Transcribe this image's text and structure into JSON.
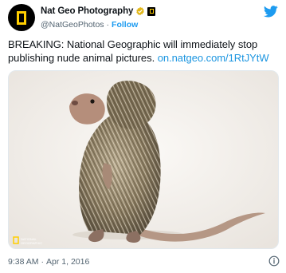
{
  "account": {
    "display_name": "Nat Geo Photography",
    "handle": "@NatGeoPhotos",
    "separator": "·",
    "follow_label": "Follow"
  },
  "tweet": {
    "text": "BREAKING: National Geographic will immediately stop publishing nude animal pictures. ",
    "link": "on.natgeo.com/1RtJYtW"
  },
  "photo": {
    "subject": "porcupine",
    "watermark": "NATIONAL GEOGRAPHIC"
  },
  "meta": {
    "time": "9:38 AM",
    "separator": "·",
    "date": "Apr 1, 2016"
  },
  "icons": {
    "avatar": "national-geographic-logo",
    "verified": "verified-badge-icon",
    "brand": "natgeo-brand-badge",
    "platform": "twitter-bird-icon",
    "info": "info-icon"
  },
  "colors": {
    "link": "#1b95e0",
    "follow": "#1d9bf0",
    "secondary_text": "#536471",
    "verified_gold": "#e2b719",
    "natgeo_yellow": "#ffce00",
    "twitter_blue": "#1d9bf0"
  }
}
